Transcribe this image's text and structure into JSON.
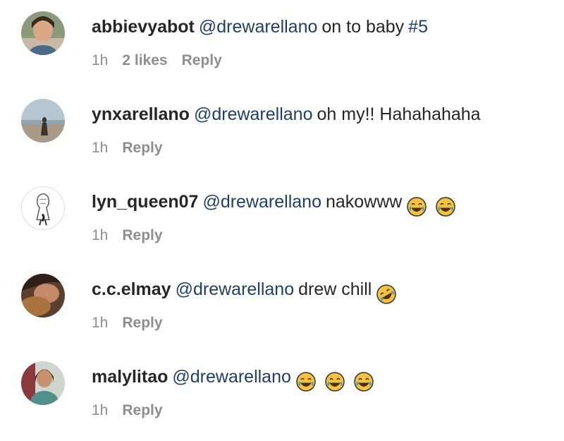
{
  "comments": [
    {
      "username": "abbievyabot",
      "mention": "@drewarellano",
      "text": "on to baby",
      "hashtag": "#5",
      "time": "1h",
      "likes": "2 likes",
      "reply": "Reply",
      "avatar": "user-photo-avatar"
    },
    {
      "username": "ynxarellano",
      "mention": "@drewarellano",
      "text": "oh my!! Hahahahaha",
      "time": "1h",
      "reply": "Reply",
      "avatar": "beach-photo-avatar"
    },
    {
      "username": "lyn_queen07",
      "mention": "@drewarellano",
      "text": "nakowww",
      "emojis": [
        "face-with-tears-of-joy-icon",
        "face-with-tears-of-joy-icon"
      ],
      "time": "1h",
      "reply": "Reply",
      "avatar": "sketch-drawing-avatar"
    },
    {
      "username": "c.c.elmay",
      "mention": "@drewarellano",
      "text": "drew chill",
      "emojis": [
        "rolling-on-floor-laughing-icon"
      ],
      "time": "1h",
      "reply": "Reply",
      "avatar": "user-photo-avatar"
    },
    {
      "username": "malylitao",
      "mention": "@drewarellano",
      "text": "",
      "emojis": [
        "face-with-tears-of-joy-icon",
        "face-with-tears-of-joy-icon",
        "face-with-tears-of-joy-icon"
      ],
      "time": "1h",
      "reply": "Reply",
      "avatar": "user-photo-avatar"
    }
  ],
  "colors": {
    "username": "#262626",
    "mention": "#1e3f6b",
    "meta": "#8e8e8e",
    "emoji_face": "#f5c23a",
    "emoji_tear": "#3d9bd8"
  }
}
